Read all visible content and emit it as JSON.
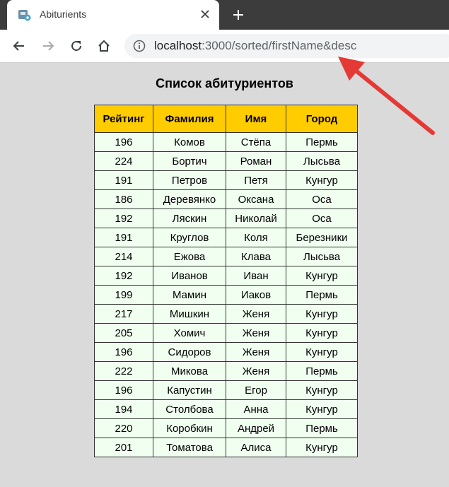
{
  "tab": {
    "title": "Abiturients"
  },
  "address_bar": {
    "host": "localhost",
    "rest": ":3000/sorted/firstName&desc"
  },
  "page": {
    "title": "Список абитуриентов"
  },
  "table": {
    "headers": [
      "Рейтинг",
      "Фамилия",
      "Имя",
      "Город"
    ],
    "rows": [
      [
        "196",
        "Комов",
        "Стёпа",
        "Пермь"
      ],
      [
        "224",
        "Бортич",
        "Роман",
        "Лысьва"
      ],
      [
        "191",
        "Петров",
        "Петя",
        "Кунгур"
      ],
      [
        "186",
        "Деревянко",
        "Оксана",
        "Оса"
      ],
      [
        "192",
        "Ляскин",
        "Николай",
        "Оса"
      ],
      [
        "191",
        "Круглов",
        "Коля",
        "Березники"
      ],
      [
        "214",
        "Ежова",
        "Клава",
        "Лысьва"
      ],
      [
        "192",
        "Иванов",
        "Иван",
        "Кунгур"
      ],
      [
        "199",
        "Мамин",
        "Иаков",
        "Пермь"
      ],
      [
        "217",
        "Мишкин",
        "Женя",
        "Кунгур"
      ],
      [
        "205",
        "Хомич",
        "Женя",
        "Кунгур"
      ],
      [
        "196",
        "Сидоров",
        "Женя",
        "Кунгур"
      ],
      [
        "222",
        "Микова",
        "Женя",
        "Пермь"
      ],
      [
        "196",
        "Капустин",
        "Егор",
        "Кунгур"
      ],
      [
        "194",
        "Столбова",
        "Анна",
        "Кунгур"
      ],
      [
        "220",
        "Коробкин",
        "Андрей",
        "Пермь"
      ],
      [
        "201",
        "Томатова",
        "Алиса",
        "Кунгур"
      ]
    ]
  },
  "colors": {
    "header_bg": "#ffcc00",
    "row_bg": "#f0fff0",
    "arrow": "#e53935"
  }
}
